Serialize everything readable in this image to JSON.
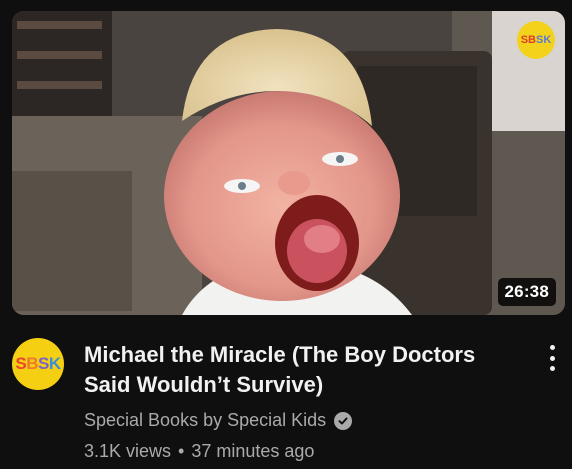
{
  "video": {
    "duration": "26:38",
    "title": "Michael the Miracle (The Boy Doctors Said Wouldn’t Survive)",
    "views": "3.1K views",
    "separator": "•",
    "age": "37 minutes ago"
  },
  "channel": {
    "name": "Special Books by Special Kids",
    "avatar_letters": [
      "S",
      "B",
      "S",
      "K"
    ],
    "watermark_letters": [
      "SB",
      "SK"
    ],
    "verified_icon": "check-circle-icon"
  },
  "menu": {
    "icon": "more-vert-icon"
  },
  "colors": {
    "background": "#0f0f0f",
    "title": "#f1f1f1",
    "secondary_text": "#aaaaaa",
    "avatar_bg": "#f4cf12"
  }
}
